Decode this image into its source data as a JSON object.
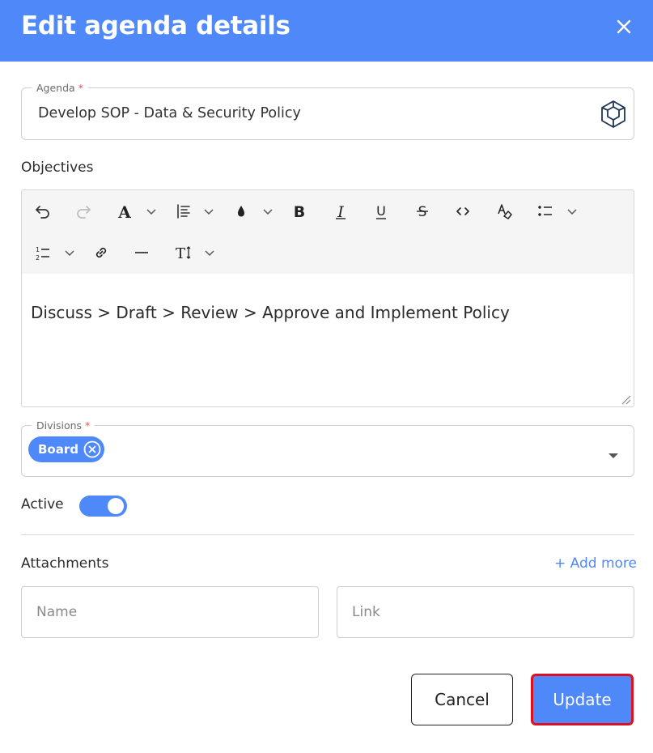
{
  "dialog": {
    "title": "Edit agenda details"
  },
  "agenda": {
    "label": "Agenda",
    "required": "*",
    "value": "Develop SOP - Data & Security Policy"
  },
  "objectives": {
    "label": "Objectives",
    "content": "Discuss > Draft > Review > Approve and Implement Policy"
  },
  "toolbar": {
    "icons": [
      "undo-icon",
      "redo-icon",
      "font-color-icon",
      "line-height-icon",
      "highlight-icon",
      "bold-icon",
      "italic-icon",
      "underline-icon",
      "strikethrough-icon",
      "code-icon",
      "clear-format-icon",
      "bulleted-list-icon",
      "numbered-list-icon",
      "link-icon",
      "horizontal-rule-icon",
      "font-size-icon"
    ],
    "font_glyph": "A",
    "bold_glyph": "B",
    "italic_glyph": "I",
    "underline_glyph": "U",
    "strike_glyph": "S",
    "size_glyph": "T"
  },
  "divisions": {
    "label": "Divisions",
    "required": "*",
    "chips": [
      "Board"
    ]
  },
  "active": {
    "label": "Active",
    "on": true
  },
  "attachments": {
    "label": "Attachments",
    "add_more": "+ Add more",
    "name_placeholder": "Name",
    "link_placeholder": "Link"
  },
  "buttons": {
    "cancel": "Cancel",
    "update": "Update"
  },
  "colors": {
    "accent": "#4f88f8",
    "focus_border": "#e0101e"
  }
}
